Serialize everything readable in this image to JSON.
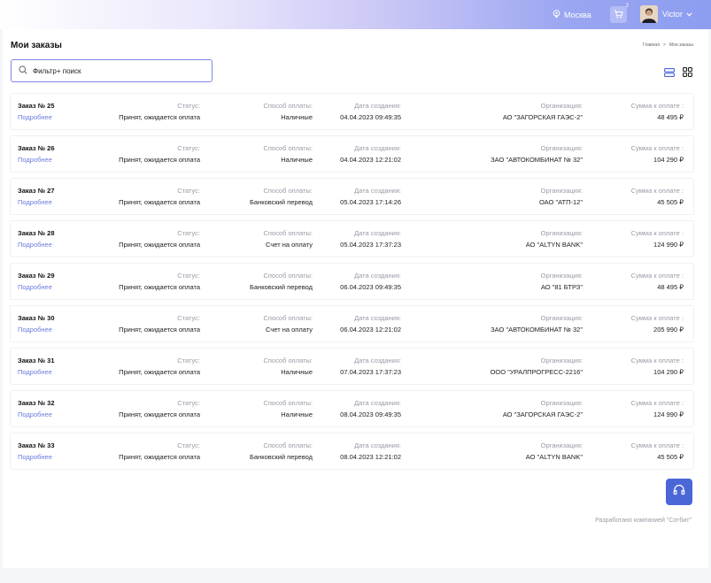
{
  "header": {
    "city": "Москва",
    "cart_count": "2",
    "user_name": "Victor"
  },
  "page": {
    "title": "Мои заказы",
    "breadcrumb": [
      "Главная",
      ">",
      "Мои заказы"
    ]
  },
  "search": {
    "placeholder": "Фильтр+ поиск"
  },
  "labels": {
    "status": "Статус:",
    "payment": "Способ оплаты:",
    "created": "Дата создания:",
    "organization": "Организация:",
    "sum": "Сумма к оплате :",
    "more": "Подробнее"
  },
  "orders": [
    {
      "number": "Заказ № 25",
      "status": "Принят, ожидается оплата",
      "payment": "Наличные",
      "date": "04.04.2023 09:49:35",
      "org": "АО \"ЗАГОРСКАЯ ГАЭС-2\"",
      "sum": "48 495 ₽"
    },
    {
      "number": "Заказ № 26",
      "status": "Принят, ожидается оплата",
      "payment": "Наличные",
      "date": "04.04.2023 12:21:02",
      "org": "ЗАО \"АВТОКОМБИНАТ № 32\"",
      "sum": "104 290 ₽"
    },
    {
      "number": "Заказ № 27",
      "status": "Принят, ожидается оплата",
      "payment": "Банковский перевод",
      "date": "05.04.2023 17:14:26",
      "org": "ОАО \"АТП-12\"",
      "sum": "45 505 ₽"
    },
    {
      "number": "Заказ № 28",
      "status": "Принят, ожидается оплата",
      "payment": "Счет на оплату",
      "date": "05.04.2023 17:37:23",
      "org": "АО \"ALTYN BANK\"",
      "sum": "124 990 ₽"
    },
    {
      "number": "Заказ № 29",
      "status": "Принят, ожидается оплата",
      "payment": "Банковский перевод",
      "date": "06.04.2023 09:49:35",
      "org": "АО \"81 БТРЗ\"",
      "sum": "48 495 ₽"
    },
    {
      "number": "Заказ № 30",
      "status": "Принят, ожидается оплата",
      "payment": "Счет на оплату",
      "date": "06.04.2023 12:21:02",
      "org": "ЗАО \"АВТОКОМБИНАТ № 32\"",
      "sum": "205 990 ₽"
    },
    {
      "number": "Заказ № 31",
      "status": "Принят, ожидается оплата",
      "payment": "Наличные",
      "date": "07.04.2023 17:37:23",
      "org": "ООО \"УРАЛПРОГРЕСС-2216\"",
      "sum": "104 290 ₽"
    },
    {
      "number": "Заказ № 32",
      "status": "Принят, ожидается оплата",
      "payment": "Наличные",
      "date": "08.04.2023 09:49:35",
      "org": "АО \"ЗАГОРСКАЯ ГАЭС-2\"",
      "sum": "124 990 ₽"
    },
    {
      "number": "Заказ № 33",
      "status": "Принят, ожидается оплата",
      "payment": "Банковский перевод",
      "date": "08.04.2023 12:21:02",
      "org": "АО \"ALTYN BANK\"",
      "sum": "45 505 ₽"
    }
  ],
  "footer": {
    "text": "Разработано компанией \"Сотбит\""
  },
  "icons": {
    "location": "location-pin-icon",
    "cart": "cart-icon",
    "chevron": "chevron-down-icon",
    "search": "search-icon",
    "list_view": "list-view-icon",
    "grid_view": "grid-view-icon",
    "support": "headphones-icon"
  },
  "colors": {
    "accent": "#4b66d6",
    "link": "#6b7bdc",
    "muted": "#9a9aa6",
    "search_border": "#7d87e8"
  }
}
